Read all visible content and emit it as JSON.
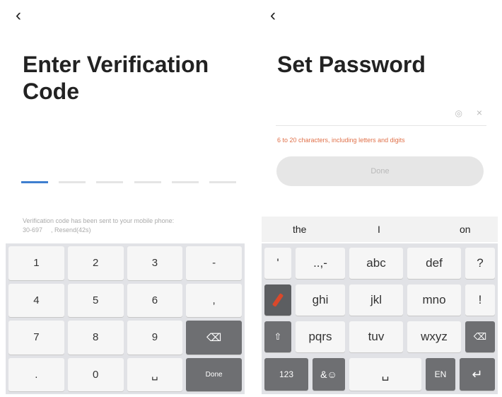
{
  "left": {
    "back_icon": "‹",
    "title": "Enter Verification Code",
    "note_line1": "Verification code has been sent to your mobile phone:",
    "note_phone": "30-697",
    "note_resend": ", Resend(42s)",
    "keypad": [
      "1",
      "2",
      "3",
      "-",
      "4",
      "5",
      "6",
      ",",
      "7",
      "8",
      "9",
      "⌫",
      ".",
      "0",
      "␣",
      "Done"
    ]
  },
  "right": {
    "back_icon": "‹",
    "title": "Set Password",
    "eye_icon": "◎",
    "clear_icon": "×",
    "hint": "6 to 20 characters, including letters and digits",
    "done_label": "Done",
    "suggestions": [
      "the",
      "I",
      "on"
    ],
    "keyboard": {
      "row1": [
        "'",
        "..,-",
        "abc",
        "def",
        "?"
      ],
      "row2": [
        "ghi",
        "jkl",
        "mno",
        "!"
      ],
      "row3": [
        "pqrs",
        "tuv",
        "wxyz"
      ],
      "row4_left": "123",
      "row4_emoji": "&☺",
      "row4_lang": "EN",
      "shift_icon": "⇧",
      "backspace_icon": "⌫",
      "enter_icon": "↵",
      "space_icon": "␣"
    }
  }
}
